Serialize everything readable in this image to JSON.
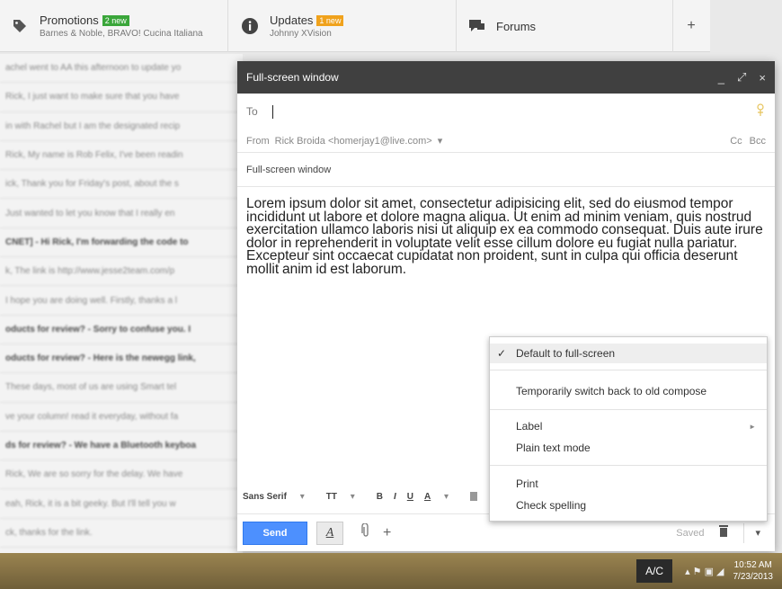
{
  "tabs": [
    {
      "title": "Promotions",
      "badge": "2 new",
      "badge_color": "#3aa63a",
      "sub": "Barnes & Noble, BRAVO! Cucina Italiana",
      "icon": "tag-icon"
    },
    {
      "title": "Updates",
      "badge": "1 new",
      "badge_color": "#f0a21c",
      "sub": "Johnny XVision",
      "icon": "info-icon"
    },
    {
      "title": "Forums",
      "icon": "chat-bubble-icon"
    }
  ],
  "add_tab_label": "+",
  "mail_rows": [
    "achel went to AA this afternoon to update yo",
    "Rick, I just want to make sure that you have",
    "in with Rachel but I am the designated recip",
    "Rick, My name is Rob Felix, I've been readin",
    "ick, Thank you for Friday's post, about the s",
    "Just wanted to let you know that I really en",
    "CNET] - Hi Rick, I'm forwarding the code to",
    "k, The link is http://www.jesse2team.com/p",
    "I hope you are doing well. Firstly, thanks a l",
    "oducts for review? - Sorry to confuse you. I",
    "oducts for review? - Here is the newegg link,",
    "These days, most of us are using Smart tel",
    "ve your column! read it everyday, without fa",
    "ds for review? - We have a Bluetooth keyboa",
    "Rick, We are so sorry for the delay. We have",
    "eah, Rick, it is a bit geeky. But I'll tell you w",
    "ck, thanks for the link."
  ],
  "compose": {
    "title": "Full-screen window",
    "minimize": "_",
    "expand": "⤢",
    "close": "×",
    "to_label": "To",
    "from_label": "From",
    "from_value": "Rick Broida <homerjay1@live.com>",
    "from_dropdown": "▾",
    "cc": "Cc",
    "bcc": "Bcc",
    "subject": "Full-screen window",
    "body": "Lorem ipsum dolor sit amet, consectetur adipisicing elit, sed do eiusmod tempor incididunt ut labore et dolore magna aliqua. Ut enim ad minim veniam, quis nostrud exercitation ullamco laboris nisi ut aliquip ex ea commodo consequat. Duis aute irure dolor in reprehenderit in voluptate velit esse cillum dolore eu fugiat nulla pariatur. Excepteur sint occaecat cupidatat non proident, sunt in culpa qui officia deserunt mollit anim id est laborum.",
    "toolbar": {
      "font": "Sans Serif",
      "size": "TT",
      "bold": "B",
      "italic": "I",
      "underline": "U",
      "text_color": "A",
      "caret": "▾"
    },
    "send": "Send",
    "format_label": "A",
    "attach_icon_glyph": "⊘",
    "plus": "+",
    "saved": "Saved",
    "trash_glyph": "■",
    "more": "▾"
  },
  "menu": {
    "check": "✓",
    "default_full_screen": "Default to full-screen",
    "old_compose": "Temporarily switch back to old compose",
    "label": "Label",
    "label_arrow": "►",
    "plain_text": "Plain text mode",
    "print": "Print",
    "check_spelling": "Check spelling"
  },
  "taskbar": {
    "ac": "A/C",
    "tray": "▴  ⚑  ▣  ◢",
    "time": "10:52 AM",
    "date": "7/23/2013"
  }
}
